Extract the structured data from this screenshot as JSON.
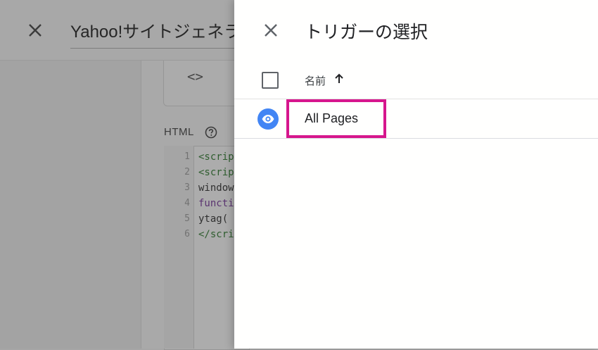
{
  "background_editor": {
    "tag_title": "Yahoo!サイトジェネラルタグ",
    "code_icon": "<>",
    "html_label": "HTML",
    "code_lines": [
      {
        "num": "1",
        "text": "<script"
      },
      {
        "num": "2",
        "text": "<script"
      },
      {
        "num": "3",
        "text": "window"
      },
      {
        "num": "4",
        "text": "function"
      },
      {
        "num": "5",
        "text": "ytag("
      },
      {
        "num": "6",
        "text": "</script"
      }
    ]
  },
  "drawer": {
    "title": "トリガーの選択",
    "column_header": "名前",
    "sort_direction": "ascending",
    "triggers": [
      {
        "name": "All Pages",
        "icon": "eye-icon",
        "icon_color": "#4285f4"
      }
    ]
  },
  "colors": {
    "highlight": "#d6168d",
    "trigger_icon_bg": "#4285f4"
  }
}
